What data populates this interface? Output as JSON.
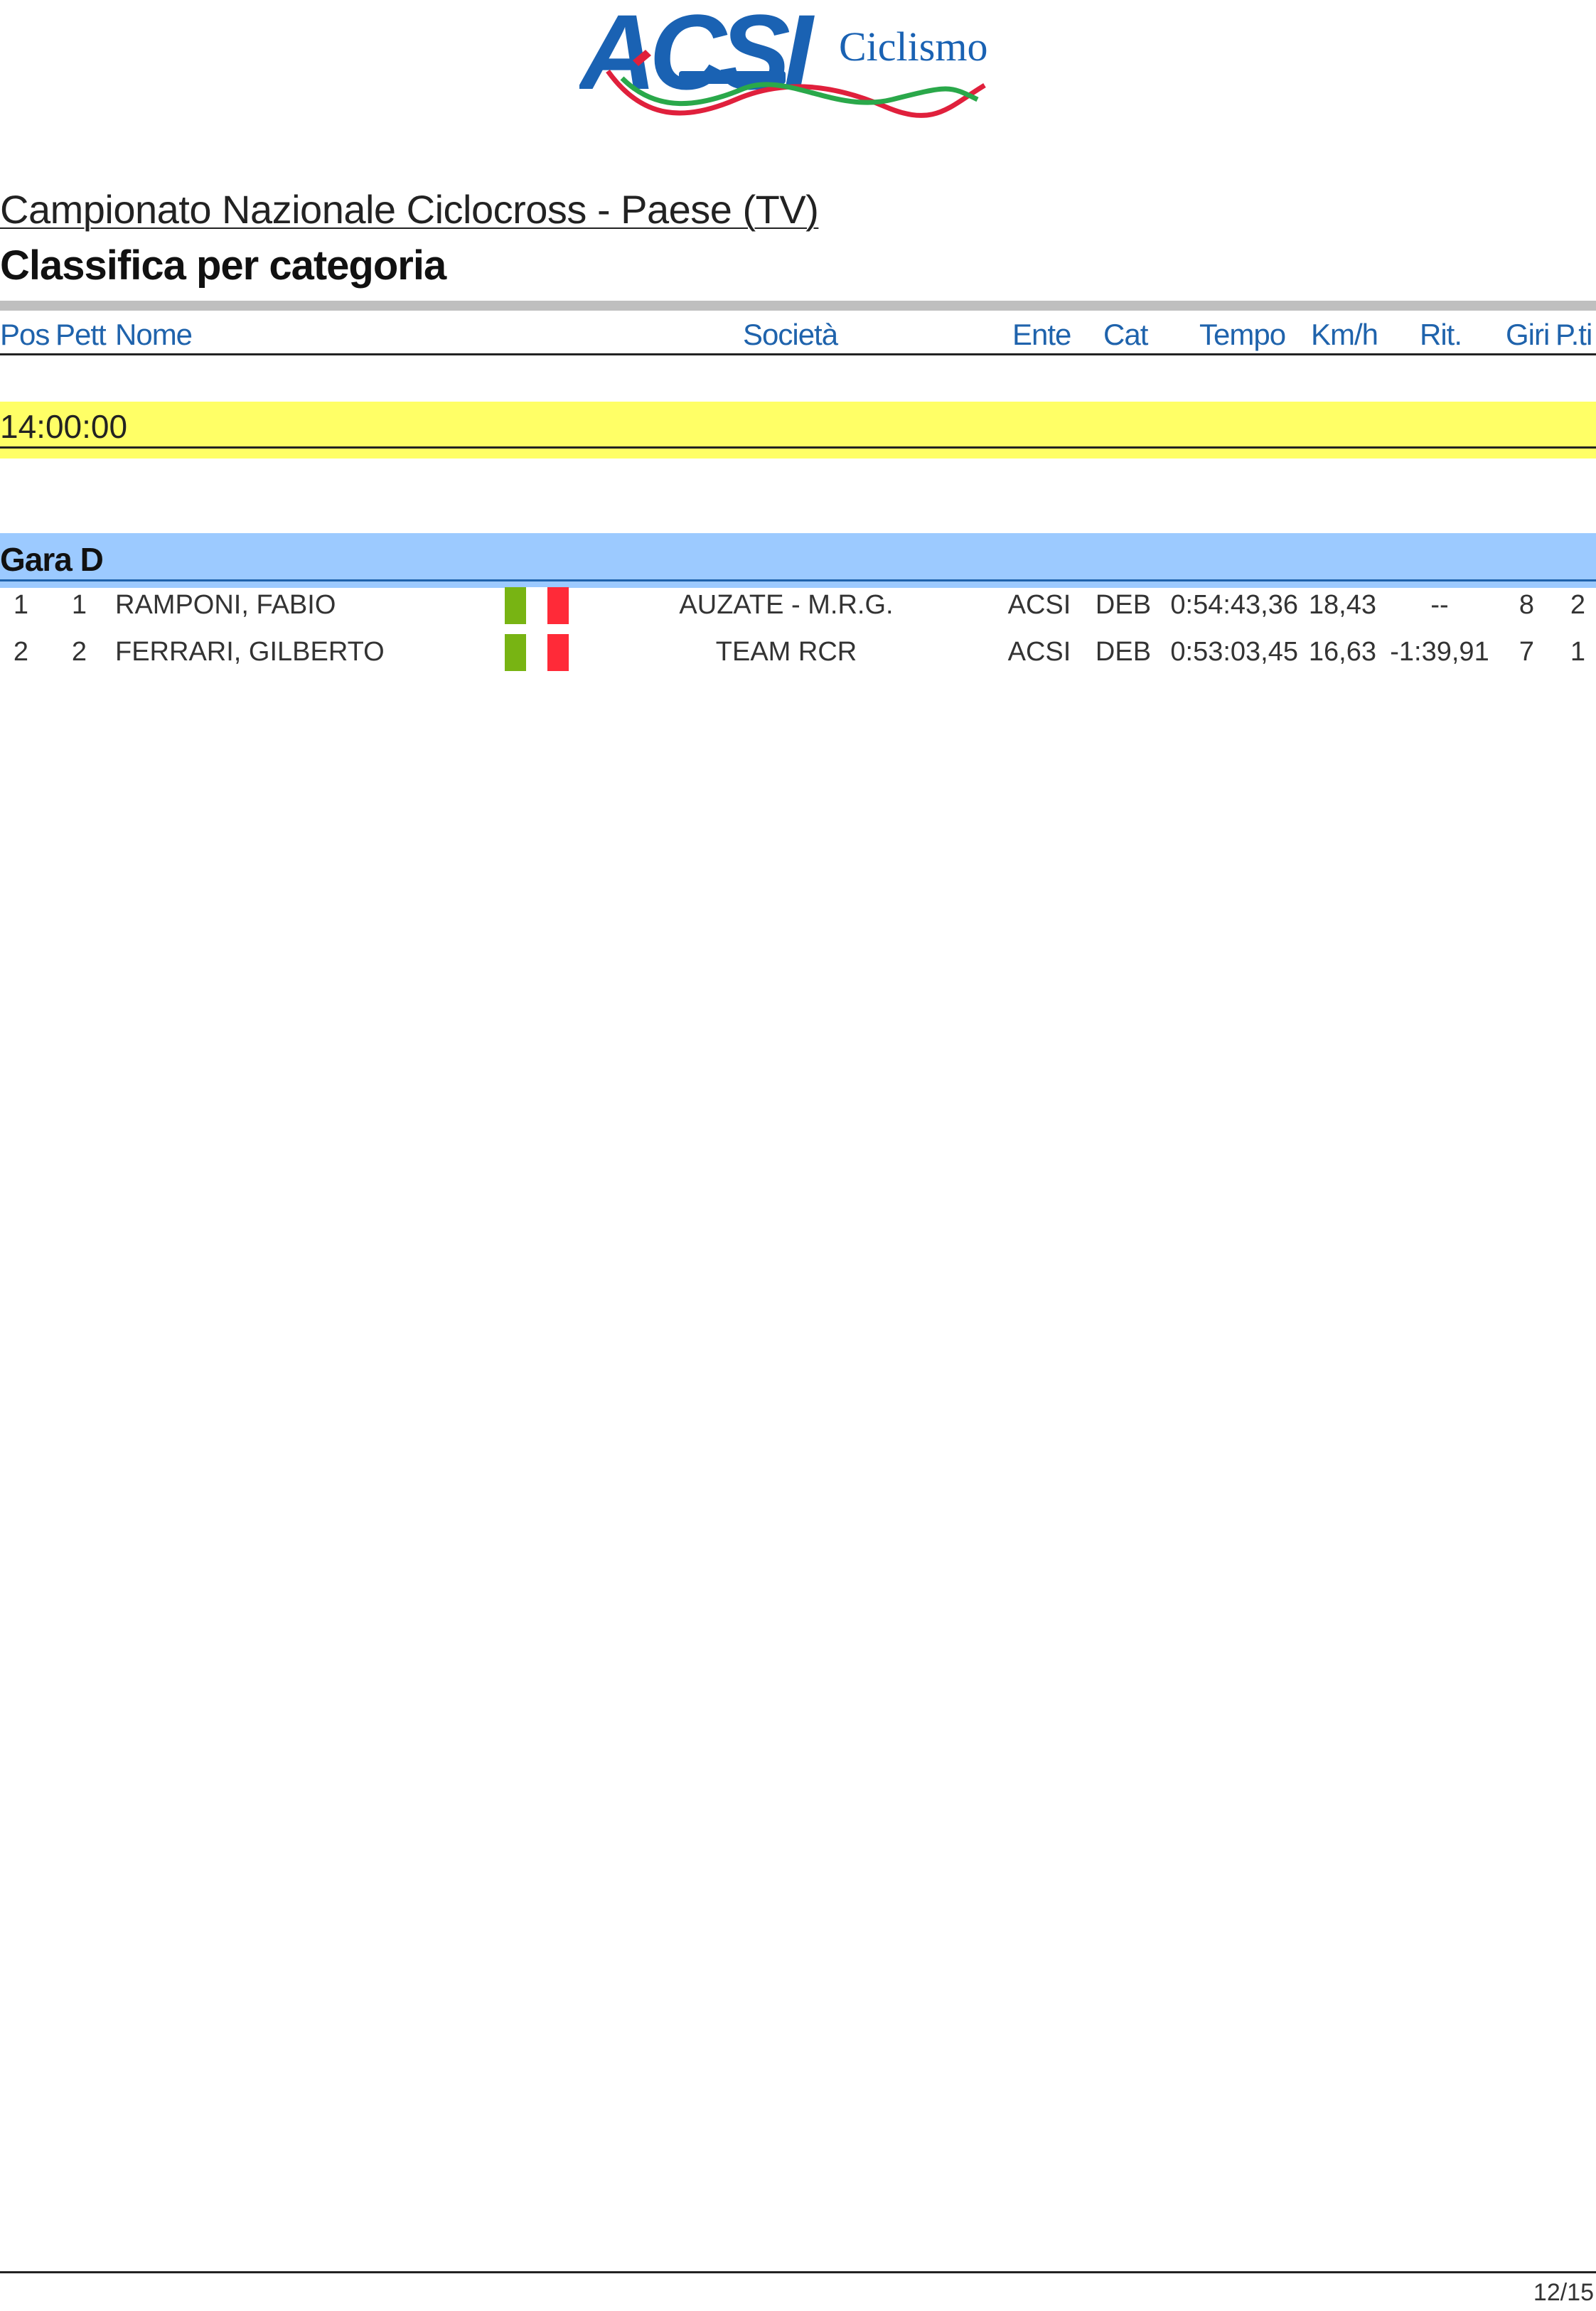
{
  "logo": {
    "text": "ACSI",
    "brand_word": "Ciclismo",
    "colors": {
      "blue": "#1a62b3",
      "green": "#2aa84a",
      "red": "#e0203c"
    }
  },
  "title": "Campionato Nazionale Ciclocross - Paese (TV)",
  "subtitle": "Classifica per categoria",
  "columns": {
    "pos": "Pos",
    "pett": "Pett",
    "nome": "Nome",
    "societa": "Società",
    "ente": "Ente",
    "cat": "Cat",
    "tempo": "Tempo",
    "kmh": "Km/h",
    "rit": "Rit.",
    "giri": "Giri",
    "punti": "P.ti"
  },
  "start_time": "14:00:00",
  "race": {
    "name": "Gara D",
    "rows": [
      {
        "pos": "1",
        "pett": "1",
        "nome": "RAMPONI, FABIO",
        "flag": "italy",
        "societa": "AUZATE - M.R.G.",
        "ente": "ACSI",
        "cat": "DEB",
        "tempo": "0:54:43,36",
        "kmh": "18,43",
        "rit": "--",
        "giri": "8",
        "punti": "2"
      },
      {
        "pos": "2",
        "pett": "2",
        "nome": "FERRARI, GILBERTO",
        "flag": "italy",
        "societa": "TEAM RCR",
        "ente": "ACSI",
        "cat": "DEB",
        "tempo": "0:53:03,45",
        "kmh": "16,63",
        "rit": "-1:39,91",
        "giri": "7",
        "punti": "1"
      }
    ]
  },
  "flag_colors": {
    "green": "#78b413",
    "white": "#ffffff",
    "red": "#ff2a38"
  },
  "band_colors": {
    "time": "#ffff66",
    "race": "#9ccaff",
    "header_text": "#1f63ac"
  },
  "page_number": "12/15"
}
